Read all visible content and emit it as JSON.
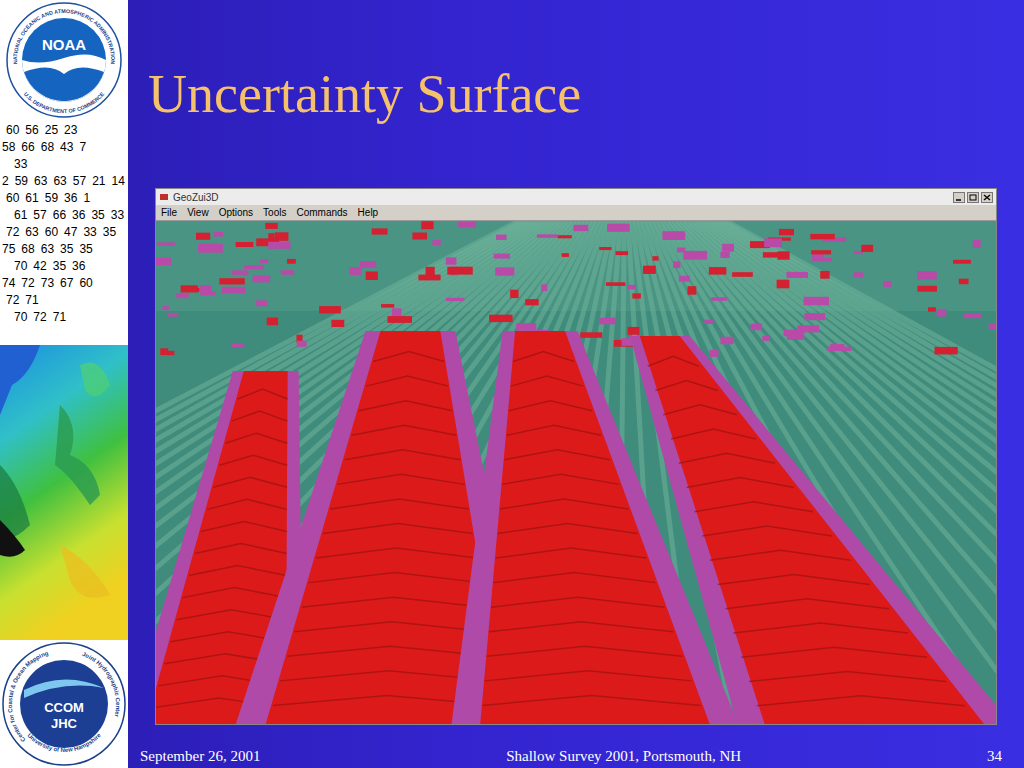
{
  "slide": {
    "title": "Uncertainty Surface",
    "date": "September 26, 2001",
    "venue": "Shallow Survey 2001, Portsmouth, NH",
    "page": "34"
  },
  "sidebar": {
    "noaa_logo": {
      "name": "NOAA",
      "ring_top": "NATIONAL OCEANIC AND ATMOSPHERIC ADMINISTRATION",
      "ring_bottom": "U.S. DEPARTMENT OF COMMERCE"
    },
    "soundings": [
      [
        "60",
        "56",
        "25",
        "23"
      ],
      [
        "58",
        "66",
        "68",
        "43",
        "7"
      ],
      [
        "33"
      ],
      [
        "2",
        "59",
        "63",
        "63",
        "57",
        "21",
        "14"
      ],
      [
        "60",
        "61",
        "59",
        "36",
        "1"
      ],
      [
        "61",
        "57",
        "66",
        "36",
        "35",
        "33"
      ],
      [
        "72",
        "63",
        "60",
        "47",
        "33",
        "35"
      ],
      [
        "75",
        "68",
        "63",
        "35",
        "35"
      ],
      [
        "70",
        "42",
        "35",
        "36"
      ],
      [
        "74",
        "72",
        "73",
        "67",
        "60"
      ],
      [
        "72",
        "71"
      ],
      [
        "70",
        "72",
        "71"
      ]
    ],
    "ccom_logo": {
      "ring_left": "Center for Coastal & Ocean Mapping",
      "ring_right": "Joint Hydrographic Center",
      "lines": [
        "CCOM",
        "JHC"
      ],
      "ring_bottom": "University of New Hampshire"
    }
  },
  "app_window": {
    "title": "GeoZui3D",
    "menu": [
      "File",
      "View",
      "Options",
      "Tools",
      "Commands",
      "Help"
    ]
  }
}
